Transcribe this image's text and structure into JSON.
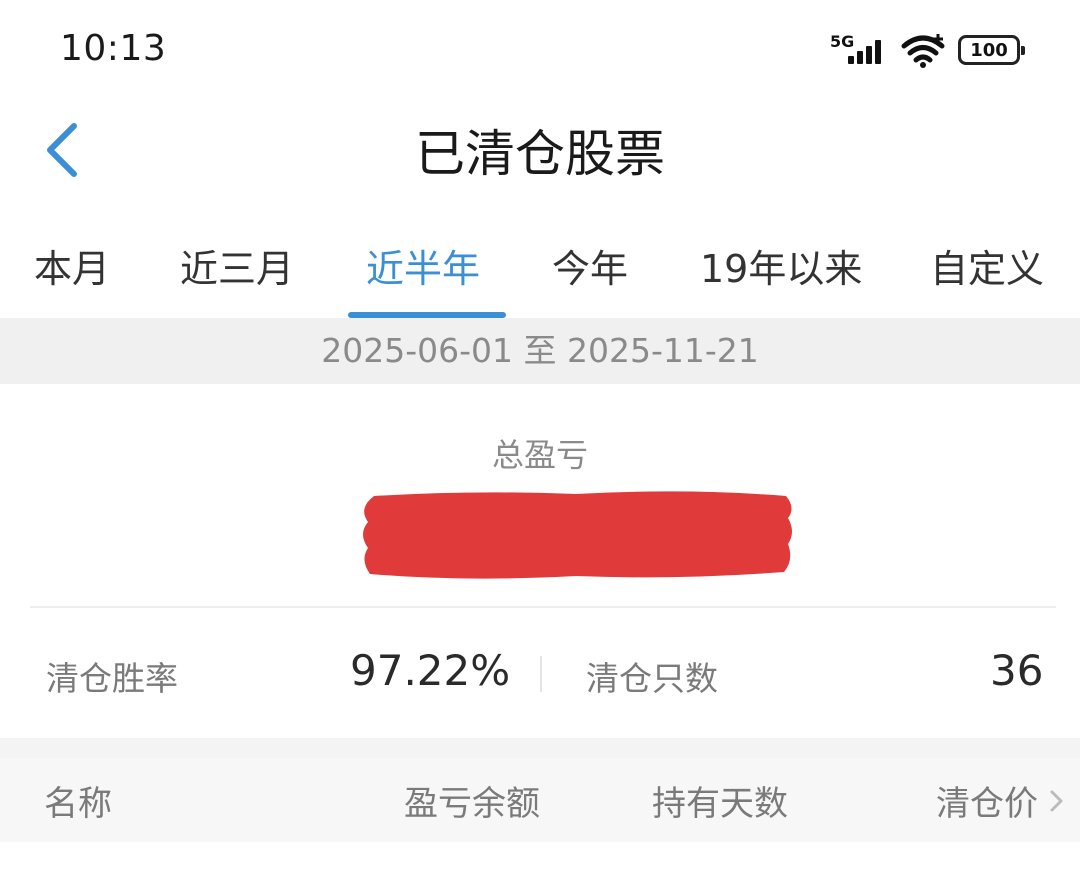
{
  "status_bar": {
    "time": "10:13",
    "network": "5G",
    "battery": "100",
    "icons": [
      "signal-icon",
      "wifi-icon",
      "battery-icon"
    ]
  },
  "header": {
    "title": "已清仓股票",
    "back_icon": "chevron-left-icon"
  },
  "tabs": [
    {
      "label": "本月",
      "active": false
    },
    {
      "label": "近三月",
      "active": false
    },
    {
      "label": "近半年",
      "active": true
    },
    {
      "label": "今年",
      "active": false
    },
    {
      "label": "19年以来",
      "active": false
    },
    {
      "label": "自定义",
      "active": false
    }
  ],
  "date_range": "2025-06-01 至 2025-11-21",
  "summary": {
    "total_label": "总盈亏",
    "total_value_redacted": true
  },
  "stats": {
    "win_rate_label": "清仓胜率",
    "win_rate_value": "97.22%",
    "count_label": "清仓只数",
    "count_value": "36"
  },
  "table": {
    "headers": [
      "名称",
      "盈亏余额",
      "持有天数",
      "清仓价"
    ],
    "sort_icon": "chevron-right-icon"
  },
  "colors": {
    "accent": "#3b8fd6",
    "redaction": "#e03a3a"
  }
}
